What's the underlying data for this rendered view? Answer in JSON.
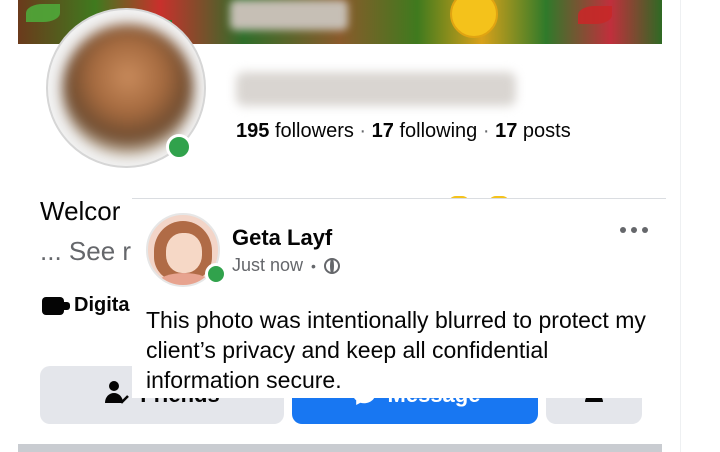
{
  "profile": {
    "stats": {
      "followers_count": "195",
      "followers_label": "followers",
      "following_count": "17",
      "following_label": "following",
      "posts_count": "17",
      "posts_label": "posts",
      "separator": "·"
    },
    "intro_partial": "Welcor",
    "see_more_partial": "... See r",
    "category_partial": "Digita",
    "online_status_color": "#31a24c"
  },
  "actions": {
    "friends_label": "Friends",
    "message_label": "Message",
    "primary_color": "#1877f2"
  },
  "post": {
    "author": "Geta Layf",
    "time": "Just now",
    "meta_separator": "•",
    "audience_icon": "globe-icon",
    "more_icon": "more-horizontal-icon",
    "text": "This photo was intentionally blurred to protect my client’s privacy and keep all confidential information secure."
  }
}
